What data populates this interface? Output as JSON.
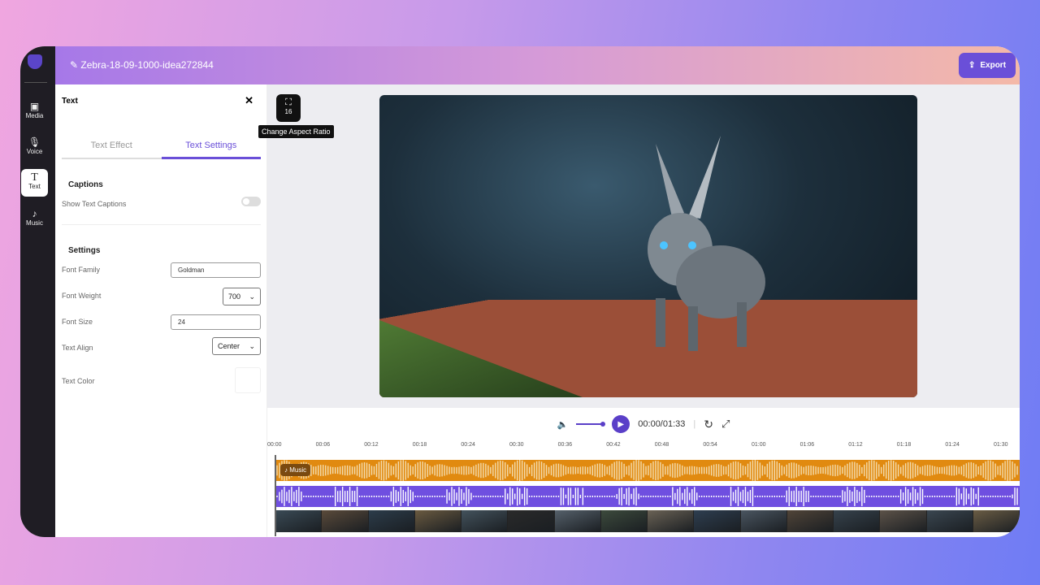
{
  "header": {
    "project_title": "Zebra-18-09-1000-idea272844",
    "export_label": "Export"
  },
  "sidebar": {
    "items": [
      {
        "label": "Media",
        "icon": "media-icon"
      },
      {
        "label": "Voice",
        "icon": "microphone-icon"
      },
      {
        "label": "Text",
        "icon": "text-icon",
        "active": true
      },
      {
        "label": "Music",
        "icon": "music-icon"
      }
    ]
  },
  "panel": {
    "title": "Text",
    "tabs": [
      {
        "label": "Text Effect"
      },
      {
        "label": "Text Settings",
        "active": true
      }
    ],
    "captions": {
      "heading": "Captions",
      "show_label": "Show Text Captions",
      "show_enabled": false
    },
    "settings": {
      "heading": "Settings",
      "font_family_label": "Font Family",
      "font_family": "Goldman",
      "font_weight_label": "Font Weight",
      "font_weight": "700",
      "font_size_label": "Font Size",
      "font_size": "24",
      "text_align_label": "Text Align",
      "text_align": "Center",
      "text_color_label": "Text Color",
      "text_color": "#ffffff"
    }
  },
  "canvas": {
    "aspect_ratio": "16",
    "aspect_tooltip": "Change Aspect Ratio"
  },
  "player": {
    "time": "00:00/01:33"
  },
  "timeline": {
    "ticks": [
      "00:00",
      "00:06",
      "00:12",
      "00:18",
      "00:24",
      "00:30",
      "00:36",
      "00:42",
      "00:48",
      "00:54",
      "01:00",
      "01:06",
      "01:12",
      "01:18",
      "01:24",
      "01:30"
    ],
    "music_label": "Music"
  },
  "colors": {
    "accent": "#6a4fd8",
    "music_track": "#e18a10",
    "voice_track": "#6f4fe0"
  }
}
